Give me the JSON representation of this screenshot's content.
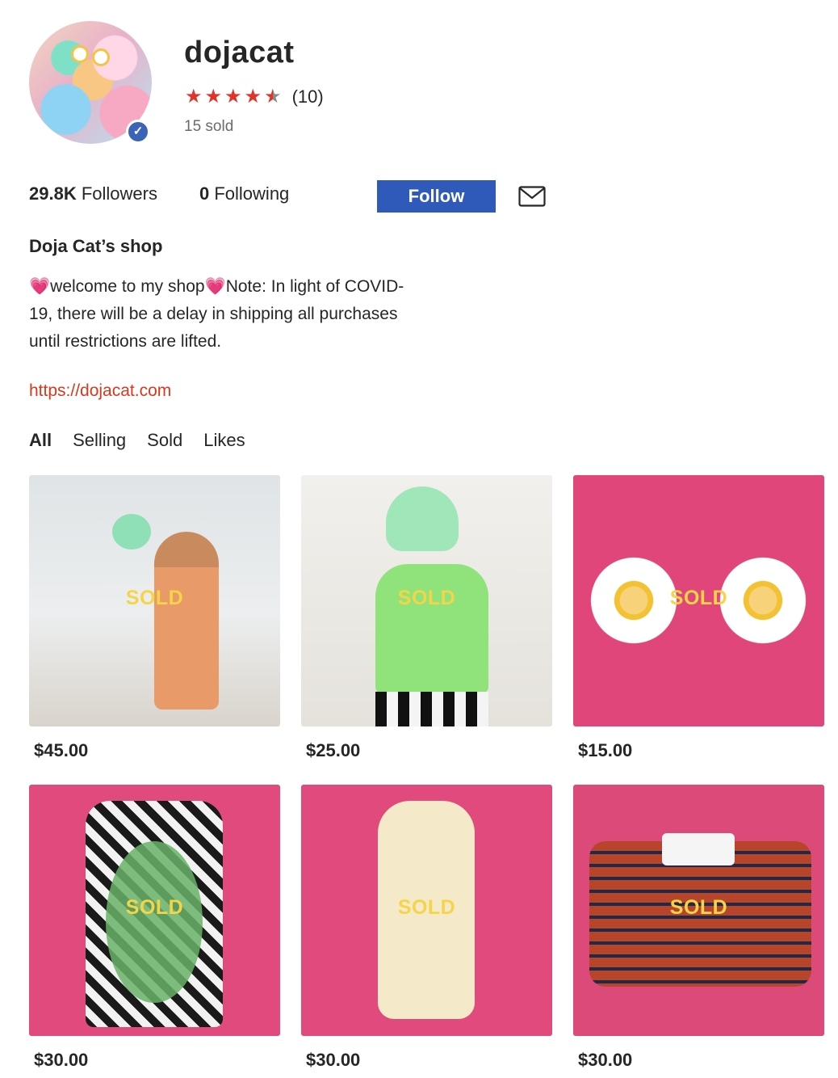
{
  "profile": {
    "username": "dojacat",
    "rating_count": "(10)",
    "sold": "15 sold",
    "rating_value": 4.5
  },
  "stats": {
    "followers_count": "29.8K",
    "followers_label": "Followers",
    "following_count": "0",
    "following_label": "Following",
    "follow_button": "Follow"
  },
  "shop": {
    "title": "Doja Cat’s shop",
    "bio": "💗welcome to my shop💗Note: In light of COVID-19, there will be a delay in shipping all purchases until restrictions are lifted.",
    "link": "https://dojacat.com"
  },
  "tabs": [
    {
      "label": "All",
      "active": true
    },
    {
      "label": "Selling",
      "active": false
    },
    {
      "label": "Sold",
      "active": false
    },
    {
      "label": "Likes",
      "active": false
    }
  ],
  "products": [
    {
      "status": "SOLD",
      "price": "$45.00"
    },
    {
      "status": "SOLD",
      "price": "$25.00"
    },
    {
      "status": "SOLD",
      "price": "$15.00"
    },
    {
      "status": "SOLD",
      "price": "$30.00"
    },
    {
      "status": "SOLD",
      "price": "$30.00"
    },
    {
      "status": "SOLD",
      "price": "$30.00"
    }
  ],
  "colors": {
    "star": "#e0342a",
    "follow_button": "#2f5aba",
    "link": "#d9381e",
    "sold_label": "#f5d547"
  }
}
